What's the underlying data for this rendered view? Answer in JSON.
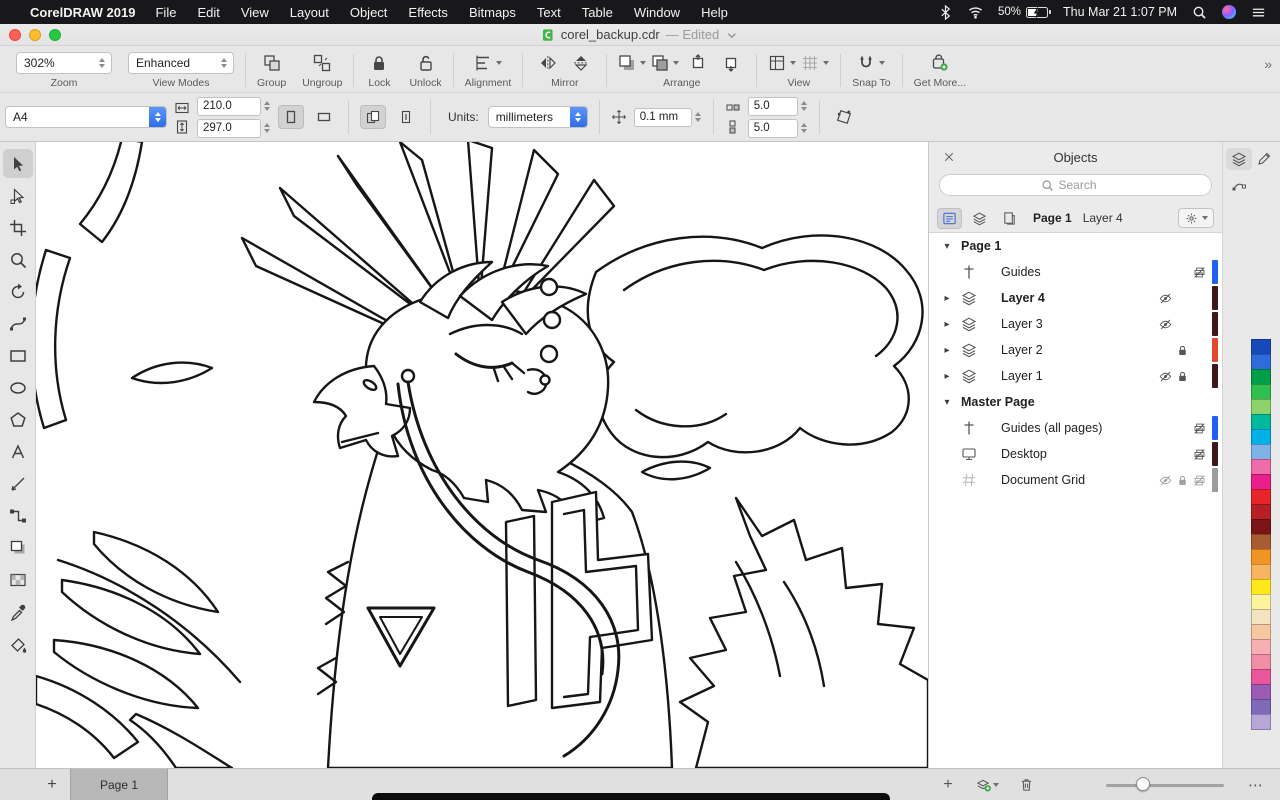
{
  "menu_bar": {
    "apple_glyph": "",
    "app_name": "CorelDRAW 2019",
    "items": [
      "File",
      "Edit",
      "View",
      "Layout",
      "Object",
      "Effects",
      "Bitmaps",
      "Text",
      "Table",
      "Window",
      "Help"
    ],
    "battery_percent": "50%",
    "clock": "Thu Mar 21 1:07 PM"
  },
  "title_bar": {
    "filename": "corel_backup.cdr",
    "edited_suffix": "— Edited"
  },
  "toolbar": {
    "zoom_value": "302%",
    "zoom_label": "Zoom",
    "view_mode_value": "Enhanced",
    "view_modes_label": "View Modes",
    "group_label": "Group",
    "ungroup_label": "Ungroup",
    "lock_label": "Lock",
    "unlock_label": "Unlock",
    "alignment_label": "Alignment",
    "mirror_label": "Mirror",
    "arrange_label": "Arrange",
    "view_label": "View",
    "snap_to_label": "Snap To",
    "get_more_label": "Get More...",
    "overflow_glyph": "»"
  },
  "property_bar": {
    "page_size": "A4",
    "page_width": "210.0",
    "page_height": "297.0",
    "units_label": "Units:",
    "units_value": "millimeters",
    "nudge_value": "0.1 mm",
    "duplicate_x": "5.0",
    "duplicate_y": "5.0"
  },
  "toolbox": {
    "tools": [
      {
        "id": "pick-tool",
        "icon": "pick",
        "active": true
      },
      {
        "id": "shape-tool",
        "icon": "shape"
      },
      {
        "id": "crop-tool",
        "icon": "crop"
      },
      {
        "id": "zoom-tool",
        "icon": "zoomtool"
      },
      {
        "id": "free-transform-tool",
        "icon": "transform"
      },
      {
        "id": "curve-tool",
        "icon": "curve"
      },
      {
        "id": "rectangle-tool",
        "icon": "recttool"
      },
      {
        "id": "ellipse-tool",
        "icon": "ellipsetool"
      },
      {
        "id": "polygon-tool",
        "icon": "polygontool"
      },
      {
        "id": "text-tool",
        "icon": "texttool"
      },
      {
        "id": "dimension-tool",
        "icon": "linetool"
      },
      {
        "id": "connector-tool",
        "icon": "connector"
      },
      {
        "id": "drop-shadow-tool",
        "icon": "shadow"
      },
      {
        "id": "transparency-tool",
        "icon": "transparency"
      },
      {
        "id": "eyedropper-tool",
        "icon": "eyedropper"
      },
      {
        "id": "interactive-fill-tool",
        "icon": "fill"
      }
    ]
  },
  "objects_panel": {
    "title": "Objects",
    "search_placeholder": "Search",
    "context_page": "Page 1",
    "context_layer": "Layer 4",
    "rows": [
      {
        "kind": "page",
        "label": "Page 1"
      },
      {
        "kind": "item",
        "label": "Guides",
        "lead": "guides",
        "trail": [
          "printer-off"
        ],
        "bar": "#1e63f0"
      },
      {
        "kind": "item",
        "label": "Layer 4",
        "bold": true,
        "chevron": true,
        "lead": "layers",
        "trail": [
          "eye-off"
        ],
        "bar": "#401718"
      },
      {
        "kind": "item",
        "label": "Layer 3",
        "chevron": true,
        "lead": "layers",
        "trail": [
          "eye-off"
        ],
        "bar": "#401718"
      },
      {
        "kind": "item",
        "label": "Layer 2",
        "chevron": true,
        "lead": "layers",
        "trail": [
          "lock"
        ],
        "bar": "#e2492f"
      },
      {
        "kind": "item",
        "label": "Layer 1",
        "chevron": true,
        "lead": "layers",
        "trail": [
          "eye-off",
          "lock"
        ],
        "bar": "#401718"
      },
      {
        "kind": "page",
        "label": "Master Page"
      },
      {
        "kind": "item",
        "label": "Guides (all pages)",
        "lead": "guides",
        "trail": [
          "printer-off"
        ],
        "bar": "#1e63f0"
      },
      {
        "kind": "item",
        "label": "Desktop",
        "lead": "desktop",
        "trail": [
          "printer-off"
        ],
        "bar": "#401718"
      },
      {
        "kind": "item",
        "label": "Document Grid",
        "lead": "grid",
        "dim": true,
        "trail": [
          "eye-off",
          "lock",
          "printer-off"
        ],
        "bar": "#9c9c9c"
      }
    ]
  },
  "page_navigator": {
    "add_glyph": "+",
    "pages": [
      "Page 1"
    ],
    "active_page": "Page 1"
  },
  "docker_footer": {
    "add_glyph": "+",
    "ellipsis_glyph": "⋯"
  },
  "color_palette": {
    "colors": [
      "#1849b8",
      "#2f6bdb",
      "#009e49",
      "#2fbf4e",
      "#8ed36a",
      "#00b89c",
      "#00b0e8",
      "#7fb2e5",
      "#f06ba8",
      "#ea1e8c",
      "#e8232a",
      "#b61f24",
      "#7a1416",
      "#a85c32",
      "#f29422",
      "#f8b55f",
      "#ffe81a",
      "#fbf49c",
      "#f4e3c0",
      "#f7c8a0",
      "#f6b0b4",
      "#f08ea6",
      "#e8579b",
      "#9a5bb5",
      "#7e6ab8",
      "#b9a6d9"
    ]
  }
}
